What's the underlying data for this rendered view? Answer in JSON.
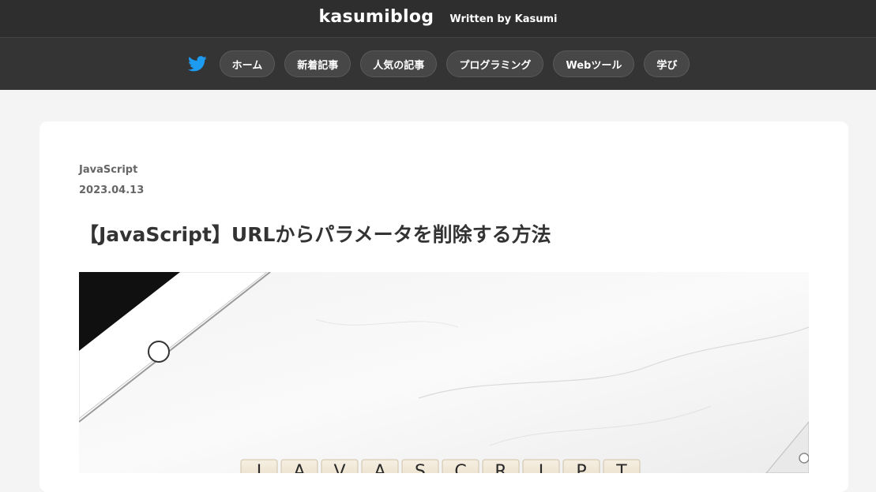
{
  "header": {
    "site_title": "kasumiblog",
    "subtitle": "Written by Kasumi"
  },
  "nav": {
    "twitter_icon": "twitter-bird-icon",
    "items": [
      {
        "label": "ホーム"
      },
      {
        "label": "新着記事"
      },
      {
        "label": "人気の記事"
      },
      {
        "label": "プログラミング"
      },
      {
        "label": "Webツール"
      },
      {
        "label": "学び"
      }
    ]
  },
  "article": {
    "category": "JavaScript",
    "date": "2023.04.13",
    "title": "【JavaScript】URLからパラメータを削除する方法",
    "hero_tiles": [
      "J",
      "A",
      "V",
      "A",
      "S",
      "C",
      "R",
      "I",
      "P",
      "T"
    ]
  },
  "colors": {
    "header_bg": "#2e2e2e",
    "nav_bg": "#343434",
    "pill_bg": "#474747",
    "twitter_blue": "#1d9bf0",
    "page_bg": "#f4f4f4",
    "card_bg": "#ffffff"
  }
}
